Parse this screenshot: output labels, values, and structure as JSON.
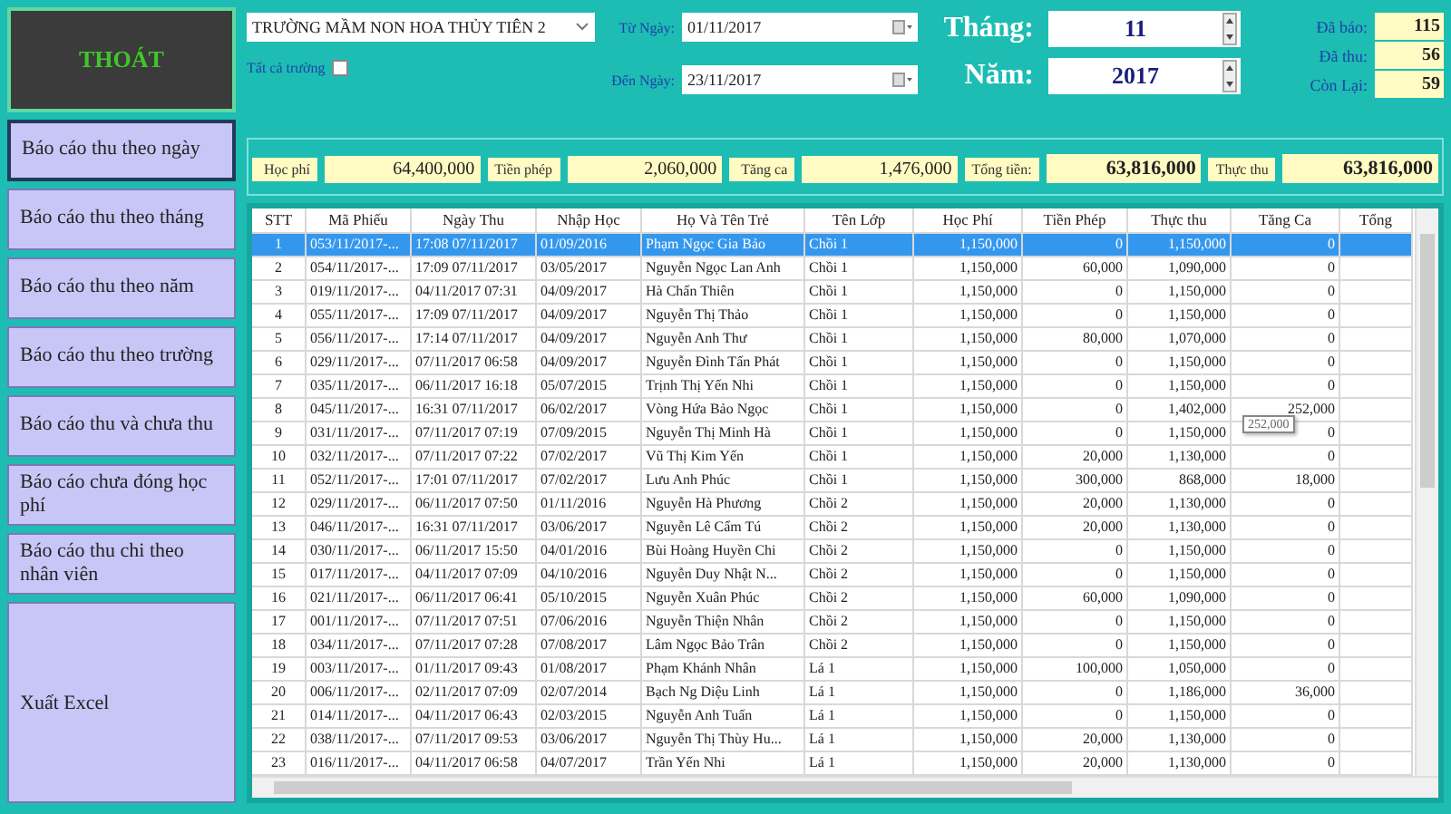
{
  "exit_button": "THOÁT",
  "menu": [
    {
      "label": "Báo cáo thu theo ngày",
      "selected": true
    },
    {
      "label": "Báo cáo thu theo tháng",
      "selected": false
    },
    {
      "label": "Báo cáo thu theo năm",
      "selected": false
    },
    {
      "label": "Báo cáo thu theo trường",
      "selected": false
    },
    {
      "label": "Báo cáo thu và chưa thu",
      "selected": false
    },
    {
      "label": "Báo cáo chưa đóng học phí",
      "selected": false
    },
    {
      "label": "Báo cáo thu chi theo nhân viên",
      "selected": false
    }
  ],
  "export_button": "Xuất Excel",
  "filters": {
    "school": "TRƯỜNG MẦM NON HOA THỦY TIÊN 2",
    "all_schools": {
      "label": "Tất cả trường",
      "checked": false
    },
    "from_label": "Từ Ngày:",
    "from_date": "01/11/2017",
    "to_label": "Đến Ngày:",
    "to_date": "23/11/2017",
    "month_label": "Tháng:",
    "month": "11",
    "year_label": "Năm:",
    "year": "2017"
  },
  "stats": [
    {
      "label": "Đã báo:",
      "value": "115"
    },
    {
      "label": "Đã thu:",
      "value": "56"
    },
    {
      "label": "Còn Lại:",
      "value": "59"
    }
  ],
  "totals": [
    {
      "label": "Học phí",
      "value": "64,400,000",
      "bold": false
    },
    {
      "label": "Tiền phép",
      "value": "2,060,000",
      "bold": false
    },
    {
      "label": "Tăng ca",
      "value": "1,476,000",
      "bold": false
    },
    {
      "label": "Tổng tiền:",
      "value": "63,816,000",
      "bold": true
    },
    {
      "label": "Thực thu",
      "value": "63,816,000",
      "bold": true
    }
  ],
  "table": {
    "columns": [
      "STT",
      "Mã Phiếu",
      "Ngày Thu",
      "Nhập Học",
      "Họ Và Tên Trẻ",
      "Tên Lớp",
      "Học Phí",
      "Tiền Phép",
      "Thực thu",
      "Tăng Ca",
      "Tổng"
    ],
    "rows": [
      {
        "cells": [
          "1",
          "053/11/2017-...",
          "17:08 07/11/2017",
          "01/09/2016",
          "Phạm Ngọc Gia Bảo",
          "Chồi 1",
          "1,150,000",
          "0",
          "1,150,000",
          "0"
        ],
        "selected": true
      },
      {
        "cells": [
          "2",
          "054/11/2017-...",
          "17:09 07/11/2017",
          "03/05/2017",
          "Nguyễn Ngọc Lan Anh",
          "Chồi 1",
          "1,150,000",
          "60,000",
          "1,090,000",
          "0"
        ],
        "selected": false
      },
      {
        "cells": [
          "3",
          "019/11/2017-...",
          "04/11/2017 07:31",
          "04/09/2017",
          "Hà Chấn Thiên",
          "Chồi 1",
          "1,150,000",
          "0",
          "1,150,000",
          "0"
        ],
        "selected": false
      },
      {
        "cells": [
          "4",
          "055/11/2017-...",
          "17:09 07/11/2017",
          "04/09/2017",
          "Nguyễn Thị Thảo",
          "Chồi 1",
          "1,150,000",
          "0",
          "1,150,000",
          "0"
        ],
        "selected": false
      },
      {
        "cells": [
          "5",
          "056/11/2017-...",
          "17:14 07/11/2017",
          "04/09/2017",
          "Nguyễn Anh Thư",
          "Chồi 1",
          "1,150,000",
          "80,000",
          "1,070,000",
          "0"
        ],
        "selected": false
      },
      {
        "cells": [
          "6",
          "029/11/2017-...",
          "07/11/2017 06:58",
          "04/09/2017",
          "Nguyễn Đình Tấn Phát",
          "Chồi 1",
          "1,150,000",
          "0",
          "1,150,000",
          "0"
        ],
        "selected": false
      },
      {
        "cells": [
          "7",
          "035/11/2017-...",
          "06/11/2017 16:18",
          "05/07/2015",
          "Trịnh Thị Yến Nhi",
          "Chồi 1",
          "1,150,000",
          "0",
          "1,150,000",
          "0"
        ],
        "selected": false
      },
      {
        "cells": [
          "8",
          "045/11/2017-...",
          "16:31 07/11/2017",
          "06/02/2017",
          "Vòng Hứa Bảo Ngọc",
          "Chồi 1",
          "1,150,000",
          "0",
          "1,402,000",
          "252,000"
        ],
        "selected": false
      },
      {
        "cells": [
          "9",
          "031/11/2017-...",
          "07/11/2017 07:19",
          "07/09/2015",
          "Nguyễn Thị Minh Hà",
          "Chồi 1",
          "1,150,000",
          "0",
          "1,150,000",
          "0"
        ],
        "selected": false
      },
      {
        "cells": [
          "10",
          "032/11/2017-...",
          "07/11/2017 07:22",
          "07/02/2017",
          "Vũ Thị Kim Yến",
          "Chồi 1",
          "1,150,000",
          "20,000",
          "1,130,000",
          "0"
        ],
        "selected": false
      },
      {
        "cells": [
          "11",
          "052/11/2017-...",
          "17:01 07/11/2017",
          "07/02/2017",
          "Lưu Anh Phúc",
          "Chồi 1",
          "1,150,000",
          "300,000",
          "868,000",
          "18,000"
        ],
        "selected": false
      },
      {
        "cells": [
          "12",
          "029/11/2017-...",
          "06/11/2017 07:50",
          "01/11/2016",
          "Nguyễn Hà Phương",
          "Chồi 2",
          "1,150,000",
          "20,000",
          "1,130,000",
          "0"
        ],
        "selected": false
      },
      {
        "cells": [
          "13",
          "046/11/2017-...",
          "16:31 07/11/2017",
          "03/06/2017",
          "Nguyễn Lê Cẩm Tú",
          "Chồi 2",
          "1,150,000",
          "20,000",
          "1,130,000",
          "0"
        ],
        "selected": false
      },
      {
        "cells": [
          "14",
          "030/11/2017-...",
          "06/11/2017 15:50",
          "04/01/2016",
          "Bùi Hoàng Huyền Chi",
          "Chồi 2",
          "1,150,000",
          "0",
          "1,150,000",
          "0"
        ],
        "selected": false
      },
      {
        "cells": [
          "15",
          "017/11/2017-...",
          "04/11/2017 07:09",
          "04/10/2016",
          "Nguyễn Duy Nhật N...",
          "Chồi 2",
          "1,150,000",
          "0",
          "1,150,000",
          "0"
        ],
        "selected": false
      },
      {
        "cells": [
          "16",
          "021/11/2017-...",
          "06/11/2017 06:41",
          "05/10/2015",
          "Nguyễn Xuân Phúc",
          "Chồi 2",
          "1,150,000",
          "60,000",
          "1,090,000",
          "0"
        ],
        "selected": false
      },
      {
        "cells": [
          "17",
          "001/11/2017-...",
          "07/11/2017 07:51",
          "07/06/2016",
          "Nguyễn Thiện Nhân",
          "Chồi 2",
          "1,150,000",
          "0",
          "1,150,000",
          "0"
        ],
        "selected": false
      },
      {
        "cells": [
          "18",
          "034/11/2017-...",
          "07/11/2017 07:28",
          "07/08/2017",
          "Lâm Ngọc Bảo Trân",
          "Chồi 2",
          "1,150,000",
          "0",
          "1,150,000",
          "0"
        ],
        "selected": false
      },
      {
        "cells": [
          "19",
          "003/11/2017-...",
          "01/11/2017 09:43",
          "01/08/2017",
          "Phạm Khánh Nhân",
          "Lá 1",
          "1,150,000",
          "100,000",
          "1,050,000",
          "0"
        ],
        "selected": false
      },
      {
        "cells": [
          "20",
          "006/11/2017-...",
          "02/11/2017 07:09",
          "02/07/2014",
          "Bạch Ng Diệu Linh",
          "Lá 1",
          "1,150,000",
          "0",
          "1,186,000",
          "36,000"
        ],
        "selected": false
      },
      {
        "cells": [
          "21",
          "014/11/2017-...",
          "04/11/2017 06:43",
          "02/03/2015",
          "Nguyễn Anh Tuấn",
          "Lá 1",
          "1,150,000",
          "0",
          "1,150,000",
          "0"
        ],
        "selected": false
      },
      {
        "cells": [
          "22",
          "038/11/2017-...",
          "07/11/2017 09:53",
          "03/06/2017",
          "Nguyễn Thị Thùy Hu...",
          "Lá 1",
          "1,150,000",
          "20,000",
          "1,130,000",
          "0"
        ],
        "selected": false
      },
      {
        "cells": [
          "23",
          "016/11/2017-...",
          "04/11/2017 06:58",
          "04/07/2017",
          "Trần Yến Nhi",
          "Lá 1",
          "1,150,000",
          "20,000",
          "1,130,000",
          "0"
        ],
        "selected": false
      }
    ],
    "tooltip": "252,000"
  }
}
